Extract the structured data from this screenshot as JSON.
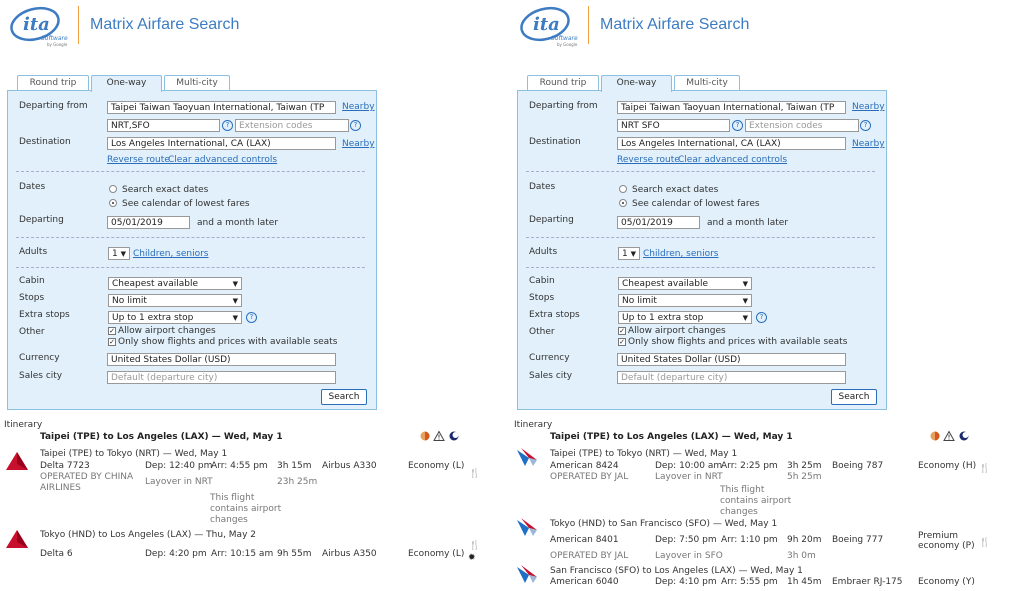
{
  "header": {
    "title": "Matrix Airfare Search",
    "logo_name": "ita",
    "logo_sub": "Software",
    "logo_by": "by Google"
  },
  "colors": {
    "brand_blue": "#3d7cc2",
    "panel_bg": "#e1f0fa",
    "link": "#2a6ebb",
    "separator": "#f0a040"
  },
  "tabs": [
    "Round trip",
    "One-way",
    "Multi-city"
  ],
  "form_labels": {
    "departing_from": "Departing from",
    "destination": "Destination",
    "dates": "Dates",
    "departing": "Departing",
    "adults": "Adults",
    "cabin": "Cabin",
    "stops": "Stops",
    "extra_stops": "Extra stops",
    "other": "Other",
    "currency": "Currency",
    "sales_city": "Sales city",
    "nearby": "Nearby",
    "reverse_route": "Reverse route",
    "clear_advanced": "Clear advanced controls",
    "search_exact": "Search exact dates",
    "see_calendar": "See calendar of lowest fares",
    "month_later": "and a month later",
    "children_seniors": "Children, seniors",
    "allow_airport_changes": "Allow airport changes",
    "only_show_available": "Only show flights and prices with available seats",
    "extension_placeholder": "Extension codes",
    "sales_placeholder": "Default (departure city)",
    "search_button": "Search",
    "itinerary": "Itinerary"
  },
  "panes": [
    {
      "form": {
        "origin": "Taipei Taiwan Taoyuan International, Taiwan (TP",
        "route_codes": "NRT,SFO",
        "destination": "Los Angeles International, CA (LAX)",
        "date": "05/01/2019",
        "adults": "1",
        "cabin": "Cheapest available",
        "stops": "No limit",
        "extra_stops": "Up to 1 extra stop",
        "currency": "United States Dollar (USD)"
      },
      "itinerary_title": "Taipei (TPE) to Los Angeles (LAX) — Wed, May 1",
      "segments": [
        {
          "route": "Taipei (TPE) to Tokyo (NRT) — Wed, May 1",
          "flight": "Delta 7723",
          "dep": "Dep: 12:40 pm",
          "arr": "Arr: 4:55 pm",
          "duration": "3h 15m",
          "aircraft": "Airbus A330",
          "cabin_class": "Economy (L)",
          "operated_1": "OPERATED BY CHINA",
          "operated_2": "AIRLINES",
          "layover": "Layover in NRT",
          "layover_time": "23h 25m",
          "note": [
            "This flight",
            "contains airport",
            "changes"
          ]
        },
        {
          "route": "Tokyo (HND) to Los Angeles (LAX) — Thu, May 2",
          "flight": "Delta 6",
          "dep": "Dep: 4:20 pm",
          "arr": "Arr: 10:15 am",
          "duration": "9h 55m",
          "aircraft": "Airbus A350",
          "cabin_class": "Economy (L)"
        }
      ]
    },
    {
      "form": {
        "origin": "Taipei Taiwan Taoyuan International, Taiwan (TP",
        "route_codes": "NRT SFO",
        "destination": "Los Angeles International, CA (LAX)",
        "date": "05/01/2019",
        "adults": "1",
        "cabin": "Cheapest available",
        "stops": "No limit",
        "extra_stops": "Up to 1 extra stop",
        "currency": "United States Dollar (USD)"
      },
      "itinerary_title": "Taipei (TPE) to Los Angeles (LAX) — Wed, May 1",
      "segments": [
        {
          "route": "Taipei (TPE) to Tokyo (NRT) — Wed, May 1",
          "flight": "American 8424",
          "dep": "Dep: 10:00 am",
          "arr": "Arr: 2:25 pm",
          "duration": "3h 25m",
          "aircraft": "Boeing 787",
          "cabin_class": "Economy (H)",
          "operated": "OPERATED BY JAL",
          "layover": "Layover in NRT",
          "layover_time": "5h 25m",
          "note": [
            "This flight",
            "contains airport",
            "changes"
          ]
        },
        {
          "route": "Tokyo (HND) to San Francisco (SFO) — Wed, May 1",
          "flight": "American 8401",
          "dep": "Dep: 7:50 pm",
          "arr": "Arr: 1:10 pm",
          "duration": "9h 20m",
          "aircraft": "Boeing 777",
          "cabin_1": "Premium",
          "cabin_2": "economy (P)",
          "operated": "OPERATED BY JAL",
          "layover": "Layover in SFO",
          "layover_time": "3h 0m"
        },
        {
          "route": "San Francisco (SFO) to Los Angeles (LAX) — Wed, May 1",
          "flight": "American 6040",
          "dep": "Dep: 4:10 pm",
          "arr": "Arr: 5:55 pm",
          "duration": "1h 45m",
          "aircraft": "Embraer RJ-175",
          "cabin_class": "Economy (Y)"
        }
      ]
    }
  ]
}
